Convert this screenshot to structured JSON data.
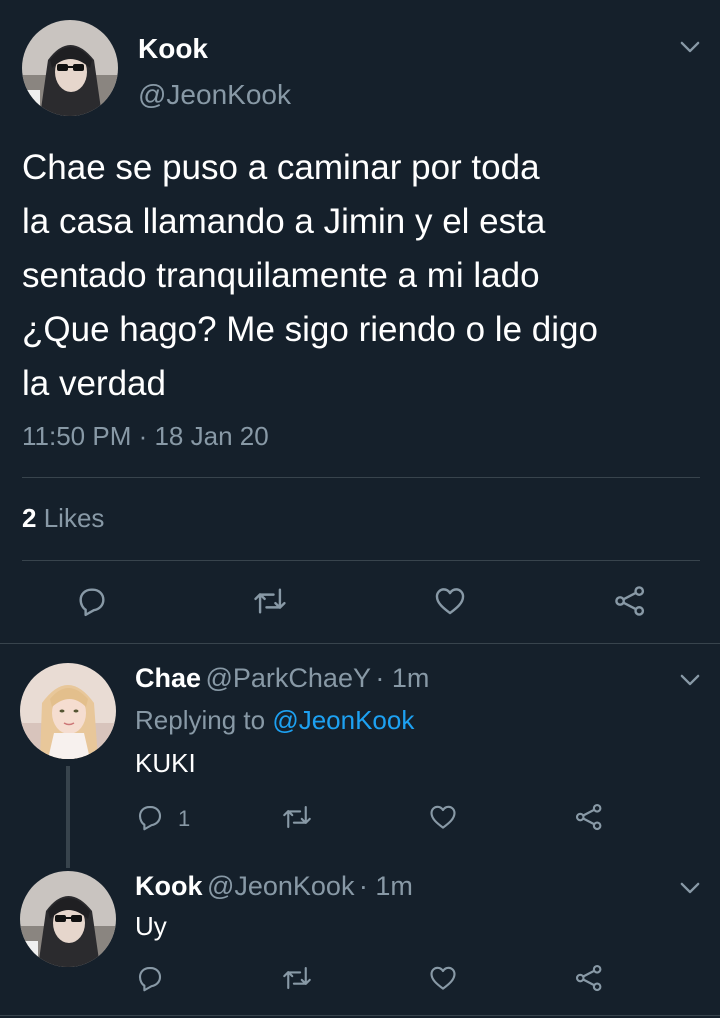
{
  "main_tweet": {
    "author_name": "Kook",
    "author_handle": "@JeonKook",
    "text": "Chae se puso a caminar por toda\nla casa llamando a Jimin y el esta\nsentado tranquilamente a mi lado\n¿Que hago? Me sigo riendo o le digo\nla verdad",
    "timestamp": "11:50 PM · 18 Jan 20",
    "likes_count": "2",
    "likes_label": "Likes"
  },
  "replies": [
    {
      "author_name": "Chae",
      "author_handle": "@ParkChaeY",
      "time": "· 1m",
      "replying_prefix": "Replying to",
      "replying_handle": "@JeonKook",
      "text": "KUKI",
      "reply_count": "1"
    },
    {
      "author_name": "Kook",
      "author_handle": "@JeonKook",
      "time": "· 1m",
      "text": "Uy"
    }
  ],
  "icons": {
    "chevron": "chevron-down-icon",
    "reply": "reply-icon",
    "retweet": "retweet-icon",
    "like": "heart-icon",
    "share": "share-icon"
  },
  "colors": {
    "background": "#15202b",
    "secondary_text": "#8899a6",
    "link": "#1da1f2",
    "divider": "#38444d"
  }
}
